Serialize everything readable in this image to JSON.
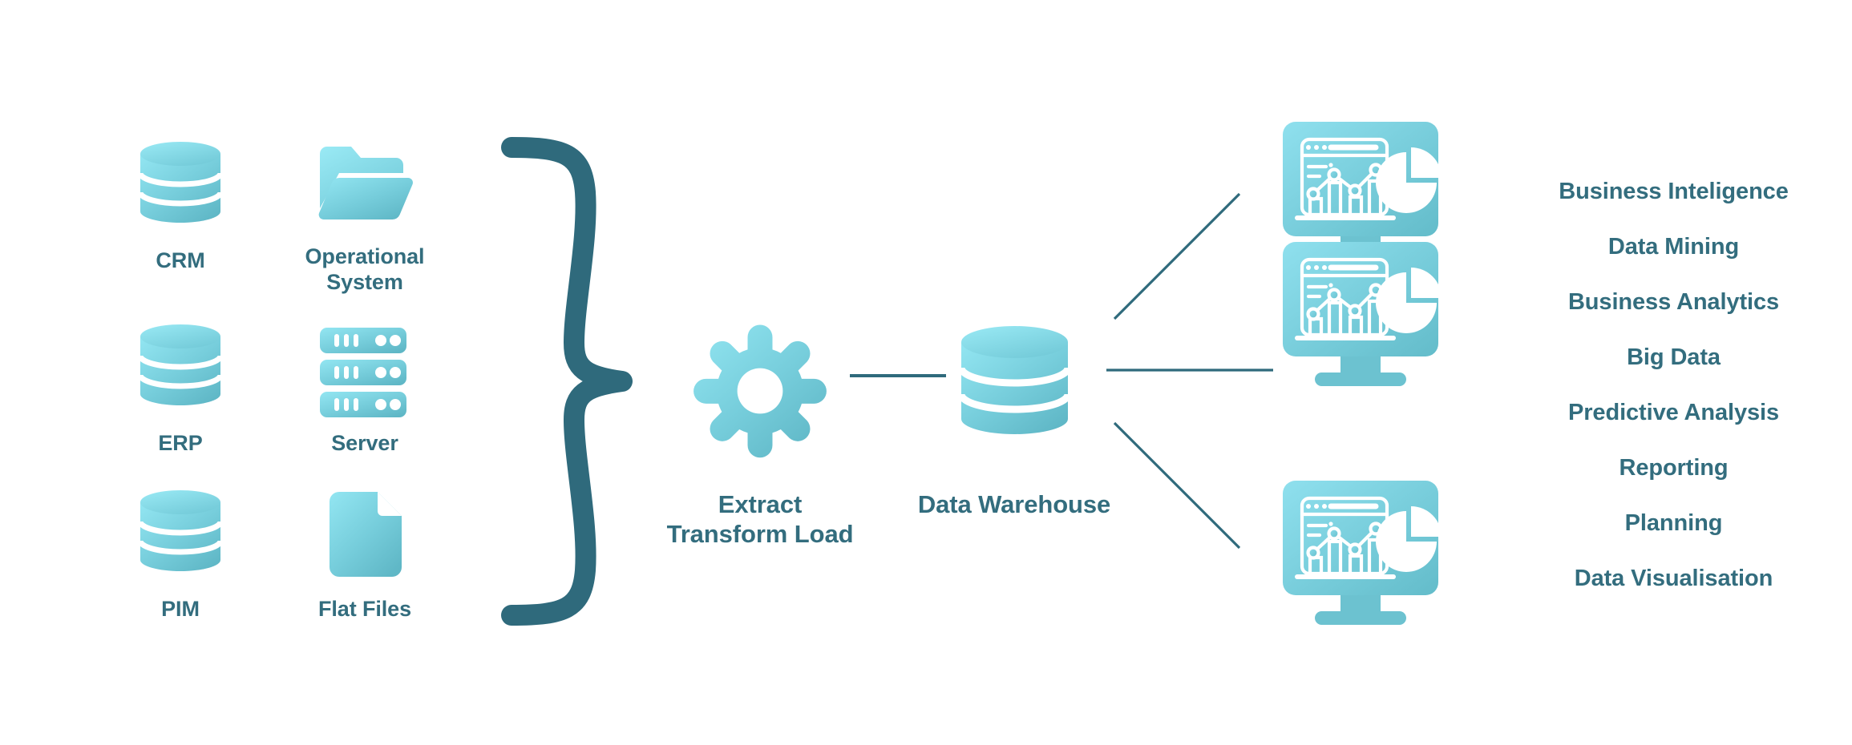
{
  "theme": {
    "background": "#ffffff",
    "text_dark_teal": "#336d7e",
    "icon_gradient_from": "#8fe3ef",
    "icon_gradient_to": "#62bcca",
    "brace_color": "#2f6a7c",
    "connector_color": "#2f6a7c"
  },
  "sources": {
    "column_left": [
      {
        "label": "CRM",
        "icon": "database-cylinder-icon"
      },
      {
        "label": "ERP",
        "icon": "database-cylinder-icon"
      },
      {
        "label": "PIM",
        "icon": "database-cylinder-icon"
      }
    ],
    "column_right": [
      {
        "label": "Operational\nSystem",
        "icon": "open-folder-icon"
      },
      {
        "label": "Server",
        "icon": "server-rack-icon"
      },
      {
        "label": "Flat Files",
        "icon": "file-document-icon"
      }
    ]
  },
  "grouping": {
    "brace": "right-curly-brace-icon"
  },
  "process": {
    "label": "Extract\nTransform Load",
    "icon": "gear-icon"
  },
  "warehouse": {
    "label": "Data Warehouse",
    "icon": "database-cylinder-large-icon"
  },
  "outputs": {
    "monitors": [
      {
        "icon": "analytics-monitor-icon"
      },
      {
        "icon": "analytics-monitor-icon"
      },
      {
        "icon": "analytics-monitor-icon"
      }
    ],
    "capabilities": [
      "Business Inteligence",
      "Data Mining",
      "Business Analytics",
      "Big Data",
      "Predictive Analysis",
      "Reporting",
      "Planning",
      "Data Visualisation"
    ]
  }
}
